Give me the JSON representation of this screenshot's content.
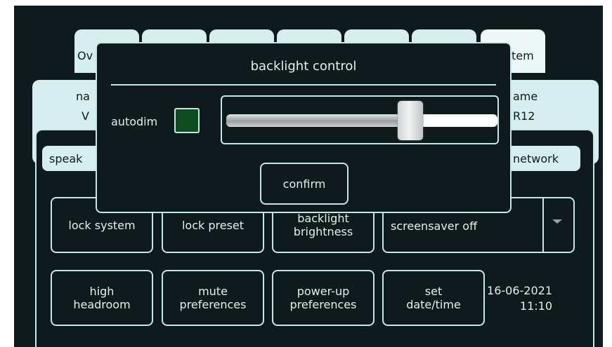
{
  "tabs": [
    {
      "label": "Ov"
    },
    {
      "label": ""
    },
    {
      "label": ""
    },
    {
      "label": ""
    },
    {
      "label": ""
    },
    {
      "label": ""
    },
    {
      "label": "tem"
    }
  ],
  "info": {
    "left_label": "na",
    "left_value": "V",
    "right_label": "ame",
    "right_value": "R12"
  },
  "sub_tabs": {
    "left": "speak",
    "right": "network"
  },
  "buttons_row1": {
    "lock_system": "lock system",
    "lock_preset": "lock preset",
    "backlight_brightness": "backlight\nbrightness"
  },
  "screensaver": {
    "selected": "screensaver off"
  },
  "buttons_row2": {
    "high_headroom": "high\nheadroom",
    "mute_preferences": "mute\npreferences",
    "power_up_preferences": "power-up\npreferences",
    "set_datetime": "set\ndate/time"
  },
  "datetime": {
    "date": "16-06-2021",
    "time": "11:10"
  },
  "modal": {
    "title": "backlight control",
    "autodim_label": "autodim",
    "autodim_checked": true,
    "brightness_level": 0.68,
    "confirm_label": "confirm"
  },
  "colors": {
    "background": "#0f1a1c",
    "panel": "#d6eef0",
    "checkbox_on": "#0e4d1f"
  }
}
